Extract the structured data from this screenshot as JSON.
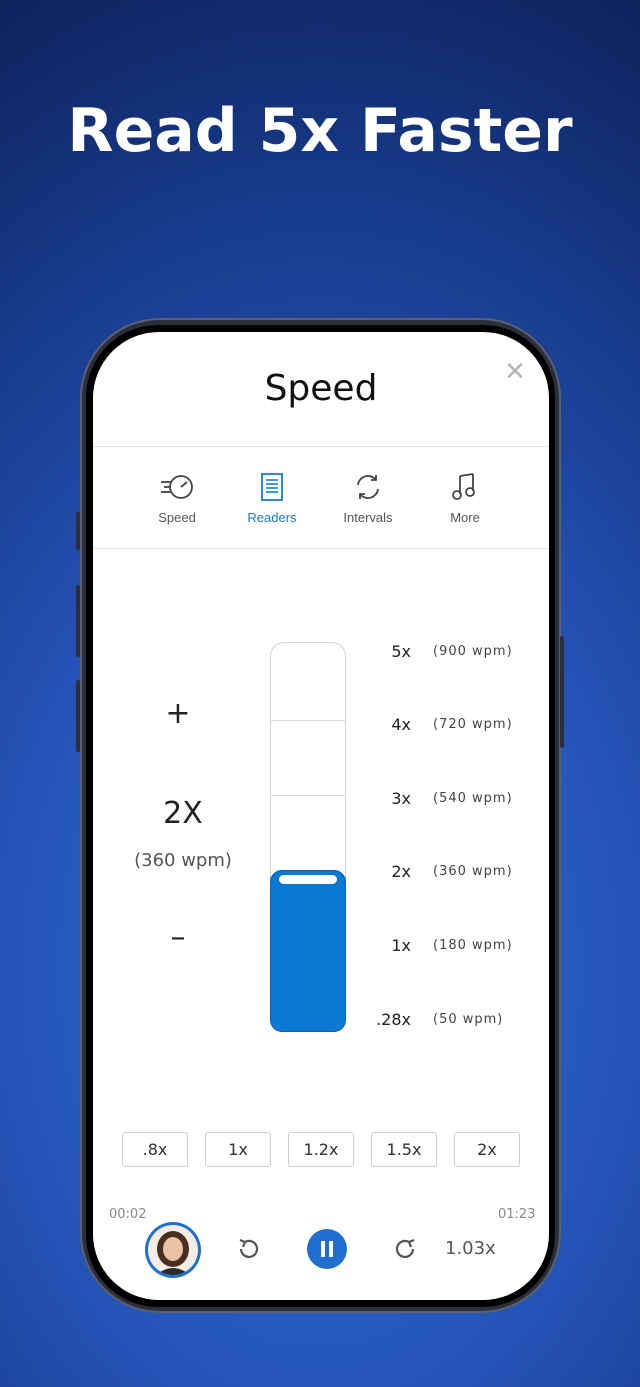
{
  "headline": "Read 5x Faster",
  "sheet": {
    "title": "Speed",
    "close_icon": "close-icon"
  },
  "tabs": [
    {
      "label": "Speed",
      "icon": "speedometer-icon",
      "active": false
    },
    {
      "label": "Readers",
      "icon": "document-icon",
      "active": true
    },
    {
      "label": "Intervals",
      "icon": "refresh-icon",
      "active": false
    },
    {
      "label": "More",
      "icon": "music-note-icon",
      "active": false
    }
  ],
  "speed_control": {
    "plus": "+",
    "minus": "–",
    "current_speed": "2X",
    "current_wpm": "(360 wpm)"
  },
  "gauge": {
    "level_fraction": 0.4,
    "levels": [
      {
        "mult": "5x",
        "wpm": "(900 wpm)"
      },
      {
        "mult": "4x",
        "wpm": "(720 wpm)"
      },
      {
        "mult": "3x",
        "wpm": "(540 wpm)"
      },
      {
        "mult": "2x",
        "wpm": "(360 wpm)"
      },
      {
        "mult": "1x",
        "wpm": "(180 wpm)"
      },
      {
        "mult": ".28x",
        "wpm": "(50 wpm)"
      }
    ]
  },
  "presets": [
    ".8x",
    "1x",
    "1.2x",
    "1.5x",
    "2x"
  ],
  "player": {
    "elapsed": "00:02",
    "duration": "01:23",
    "playback_speed": "1.03x",
    "accent": "#1f6fd0"
  }
}
